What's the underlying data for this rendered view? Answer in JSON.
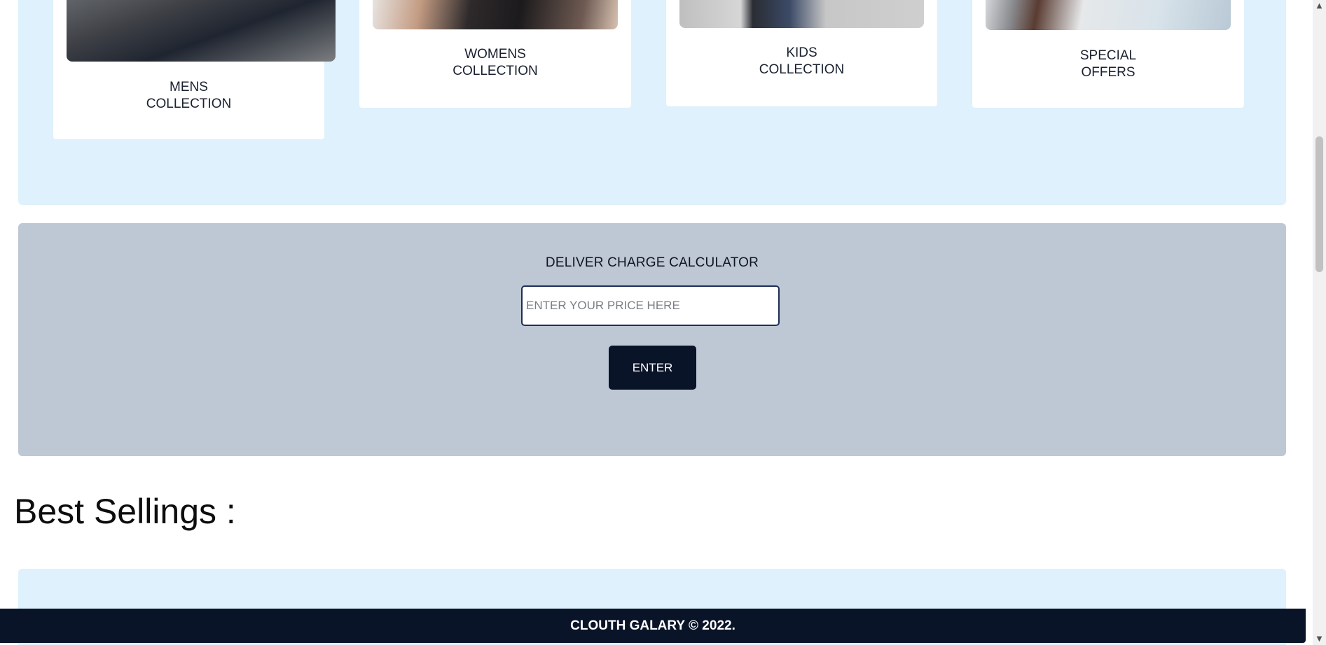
{
  "collections": [
    {
      "label_line1": "MENS",
      "label_line2": "COLLECTION",
      "image": "mens-collection-photo"
    },
    {
      "label_line1": "WOMENS",
      "label_line2": "COLLECTION",
      "image": "womens-collection-photo"
    },
    {
      "label_line1": "KIDS",
      "label_line2": "COLLECTION",
      "image": "kids-collection-photo"
    },
    {
      "label_line1": "SPECIAL",
      "label_line2": "OFFERS",
      "image": "special-offers-photo"
    }
  ],
  "calculator": {
    "title": "DELIVER CHARGE CALCULATOR",
    "input_placeholder": "ENTER YOUR PRICE HERE",
    "input_value": "",
    "button_label": "ENTER"
  },
  "best_sellings": {
    "heading": "Best Sellings :"
  },
  "footer": {
    "text": "CLOUTH GALARY © 2022."
  },
  "scrollbar": {
    "up_icon": "triangle-up-icon",
    "down_icon": "triangle-down-icon"
  },
  "colors": {
    "light_band": "#def1fc",
    "calculator_band": "#bec7d4",
    "dark_navy": "#0a1428",
    "input_border": "#1e2d56"
  }
}
